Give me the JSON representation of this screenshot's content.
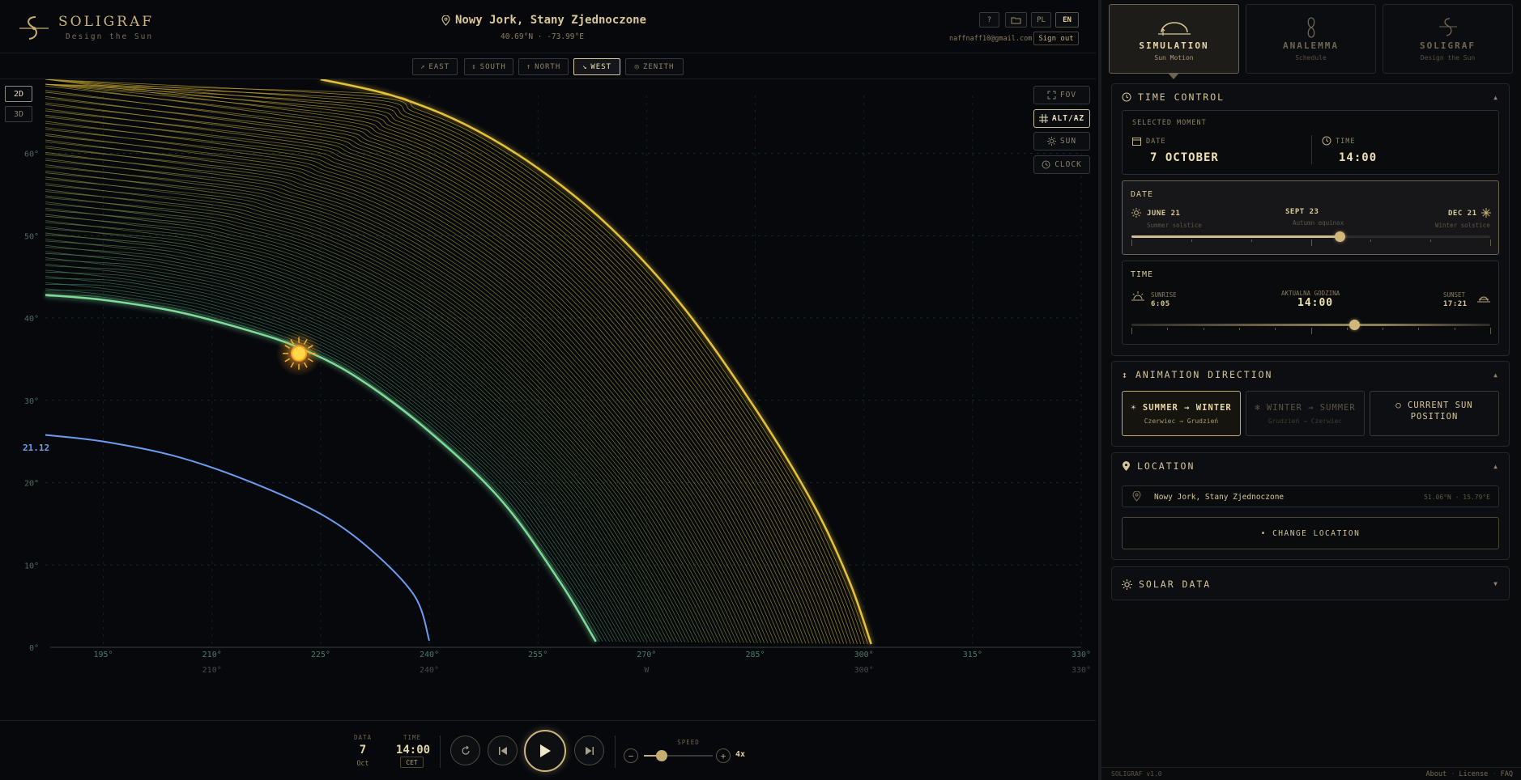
{
  "brand": {
    "name": "SOLIGRAF",
    "tagline": "Design the Sun"
  },
  "location_header": {
    "name": "Nowy Jork, Stany Zjednoczone",
    "coords": "40.69°N · -73.99°E"
  },
  "toolbar": {
    "help": "?",
    "lang_pl": "PL",
    "lang_en": "EN",
    "email": "naffnaff10@gmail.com",
    "sign_out": "Sign out"
  },
  "directions": [
    {
      "label": "EAST",
      "glyph": "↗"
    },
    {
      "label": "SOUTH",
      "glyph": "↕"
    },
    {
      "label": "NORTH",
      "glyph": "↑"
    },
    {
      "label": "WEST",
      "glyph": "↘",
      "active": true
    },
    {
      "label": "ZENITH",
      "glyph": "◎"
    }
  ],
  "view_modes": {
    "d2": "2D",
    "d3": "3D",
    "active": "2D"
  },
  "overlays": {
    "fov": "FOV",
    "altaz": "ALT/AZ",
    "sun": "SUN",
    "clock": "CLOCK",
    "active": "ALT/AZ"
  },
  "chart_data": {
    "type": "line",
    "x_axis": {
      "ticks": [
        "195°",
        "210°",
        "225°",
        "240°",
        "255°",
        "270°",
        "285°",
        "300°",
        "315°",
        "330°"
      ],
      "secondary_ticks": [
        "210°",
        "240°",
        "W",
        "300°",
        "330°"
      ],
      "range": [
        187,
        330
      ]
    },
    "y_axis": {
      "ticks": [
        "0°",
        "10°",
        "20°",
        "30°",
        "40°",
        "50°",
        "60°"
      ],
      "range": [
        0,
        69
      ]
    },
    "highlight_label": "21.12",
    "series": [
      {
        "name": "",
        "color": "#6b9cf0",
        "points": [
          [
            187,
            25.8
          ],
          [
            195,
            25.0
          ],
          [
            205,
            23.2
          ],
          [
            215,
            20.2
          ],
          [
            225,
            16.2
          ],
          [
            232,
            11.8
          ],
          [
            238,
            6.2
          ],
          [
            240,
            0.8
          ]
        ]
      },
      {
        "name": "",
        "color": "#7fdc98",
        "points": [
          [
            187,
            42.8
          ],
          [
            195,
            42.2
          ],
          [
            205,
            40.8
          ],
          [
            215,
            38.5
          ],
          [
            222,
            36.4
          ],
          [
            230,
            32.8
          ],
          [
            240,
            26.2
          ],
          [
            250,
            17.8
          ],
          [
            258,
            8.0
          ],
          [
            263,
            0.7
          ]
        ]
      },
      {
        "name": "",
        "color": "#e6c23a",
        "points": [
          [
            225,
            69.0
          ],
          [
            235,
            67.0
          ],
          [
            245,
            63.5
          ],
          [
            255,
            58.2
          ],
          [
            265,
            51.0
          ],
          [
            275,
            41.4
          ],
          [
            285,
            29.0
          ],
          [
            293,
            17.4
          ],
          [
            298,
            8.0
          ],
          [
            301,
            0.4
          ]
        ]
      }
    ],
    "sun_position": {
      "azimuth": 222,
      "altitude": 35.7
    }
  },
  "bottom": {
    "date_label": "DATA",
    "date_day": "7",
    "date_month": "Oct",
    "time_label": "TIME",
    "time_value": "14:00",
    "tz": "CET",
    "speed_label": "SPEED",
    "speed_value": "4x",
    "speed_fraction": 0.26
  },
  "modes": [
    {
      "label": "SIMULATION",
      "sub": "Sun Motion",
      "active": true
    },
    {
      "label": "ANALEMMA",
      "sub": "Schedule"
    },
    {
      "label": "SOLIGRAF",
      "sub": "Design the Sun"
    }
  ],
  "time_control": {
    "title": "TIME CONTROL",
    "selected": {
      "label": "SELECTED MOMENT",
      "date_label": "DATE",
      "date_value": "7 OCTOBER",
      "time_label": "TIME",
      "time_value": "14:00"
    },
    "date_card": {
      "title": "DATE",
      "left": "JUNE 21",
      "left_sub": "Summer solstice",
      "center": "SEPT 23",
      "center_sub": "Autumn equinox",
      "right": "DEC 21",
      "right_sub": "Winter solstice",
      "fraction": 0.58
    },
    "time_card": {
      "title": "TIME",
      "sunrise_label": "SUNRISE",
      "sunrise": "6:05",
      "current_label": "AKTUALNA GODZINA",
      "current": "14:00",
      "sunset_label": "SUNSET",
      "sunset": "17:21",
      "fraction": 0.62
    }
  },
  "animation": {
    "title": "ANIMATION DIRECTION",
    "btn1": "SUMMER → WINTER",
    "btn1_sub": "Czerwiec → Grudzień",
    "btn2": "WINTER → SUMMER",
    "btn2_sub": "Grudzień → Czerwiec",
    "btn3_line1": "CURRENT SUN",
    "btn3_line2": "POSITION"
  },
  "location": {
    "title": "LOCATION",
    "name": "Nowy Jork, Stany Zjednoczone",
    "coords": "51.06°N · 15.79°E",
    "change": "• CHANGE LOCATION"
  },
  "solar_data": {
    "title": "SOLAR DATA"
  },
  "footer": {
    "version": "SOLIGRAF v1.0",
    "about": "About",
    "license": "License",
    "faq": "FAQ"
  },
  "colors": {
    "accent": "#cdb67e",
    "winter": "#6b9cf0",
    "current": "#7fdc98",
    "summer": "#e6c23a"
  }
}
